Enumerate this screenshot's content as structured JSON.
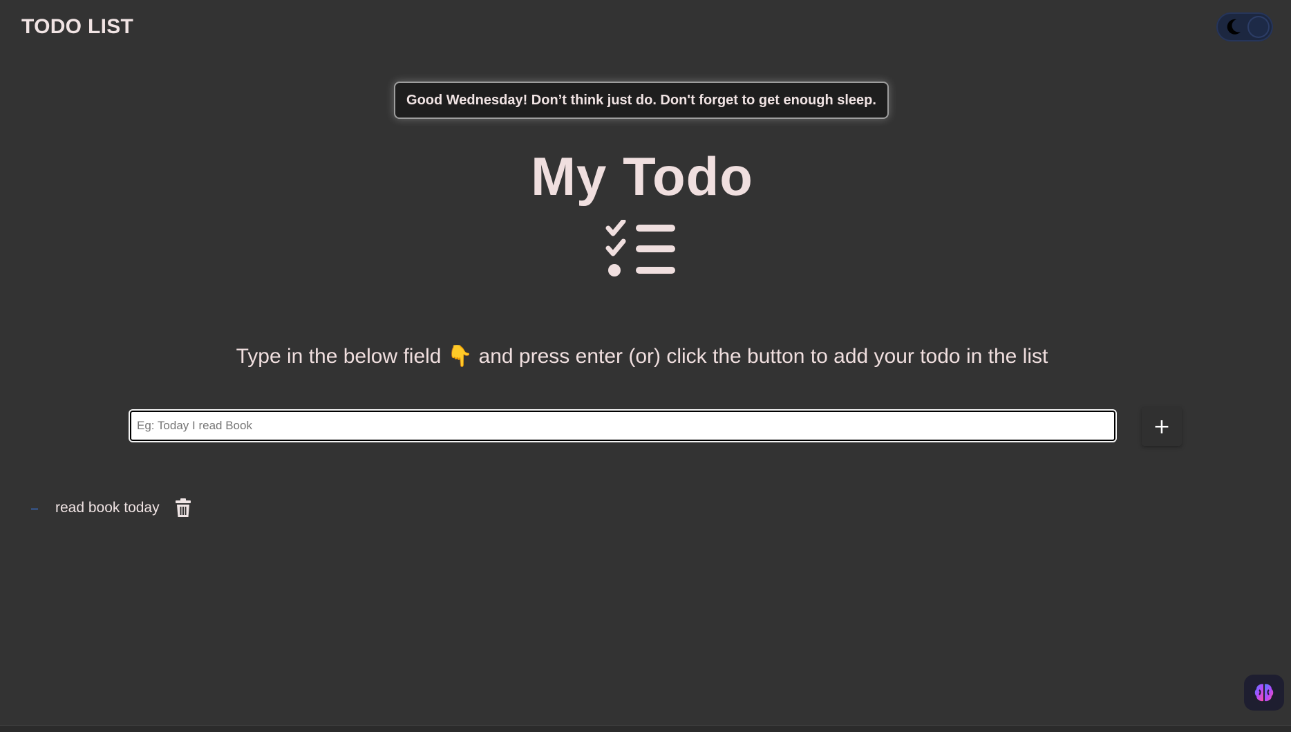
{
  "header": {
    "title": "TODO LIST",
    "theme_toggle": {
      "icon": "moon-icon",
      "state": "dark"
    }
  },
  "greeting": {
    "text": "Good Wednesday! Don’t think just do. Don't forget to get enough sleep."
  },
  "main": {
    "heading": "My Todo",
    "heading_icon": "checklist-icon",
    "instructions_before": "Type in the below field",
    "instructions_emoji": "👇",
    "instructions_after": "and press enter (or) click the button to add your todo in the list",
    "input": {
      "placeholder": "Eg: Today I read Book",
      "value": ""
    },
    "add_button_label": "+"
  },
  "todos": [
    {
      "marker": "–",
      "text": "read book today",
      "delete_icon": "trash-icon"
    }
  ],
  "floating_button": {
    "icon": "brain-icon"
  },
  "colors": {
    "background": "#333333",
    "text": "#efe3e3",
    "accent": "#3a7ae8",
    "toggle": "#1c2740"
  }
}
